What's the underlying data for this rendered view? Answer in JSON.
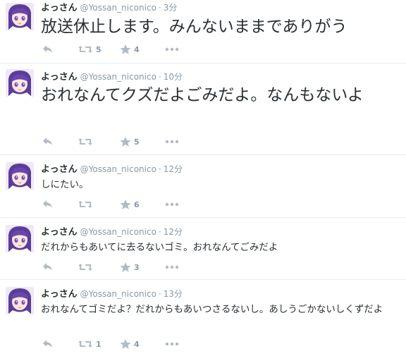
{
  "tweets": [
    {
      "user_name": "よっさん",
      "handle": "@Yossan_niconico",
      "sep": "·",
      "time": "3分",
      "text": "放送休止します。みんないままでありがう",
      "retweets": "5",
      "favorites": "4"
    },
    {
      "user_name": "よっさん",
      "handle": "@Yossan_niconico",
      "sep": "·",
      "time": "10分",
      "text": "おれなんてクズだよごみだよ。なんもないよ",
      "retweets": "",
      "favorites": "5"
    },
    {
      "user_name": "よっさん",
      "handle": "@Yossan_niconico",
      "sep": "·",
      "time": "12分",
      "text": "しにたい。",
      "retweets": "",
      "favorites": "6"
    },
    {
      "user_name": "よっさん",
      "handle": "@Yossan_niconico",
      "sep": "·",
      "time": "12分",
      "text": "だれからもあいてに去るないゴミ。おれなんてごみだよ",
      "retweets": "",
      "favorites": "3"
    },
    {
      "user_name": "よっさん",
      "handle": "@Yossan_niconico",
      "sep": "·",
      "time": "13分",
      "text": "おれなんてゴミだよ？だれからもあいつさるないし。あしうごかないしくずだよ",
      "retweets": "1",
      "favorites": "4"
    }
  ],
  "icons": {
    "reply": "reply-icon",
    "retweet": "retweet-icon",
    "favorite": "star-icon",
    "more": "more-dots-icon"
  },
  "colors": {
    "icon": "#b1bbc3",
    "secondary_text": "#8899a6",
    "primary_text": "#292f33",
    "divider": "#e6ecf0"
  }
}
